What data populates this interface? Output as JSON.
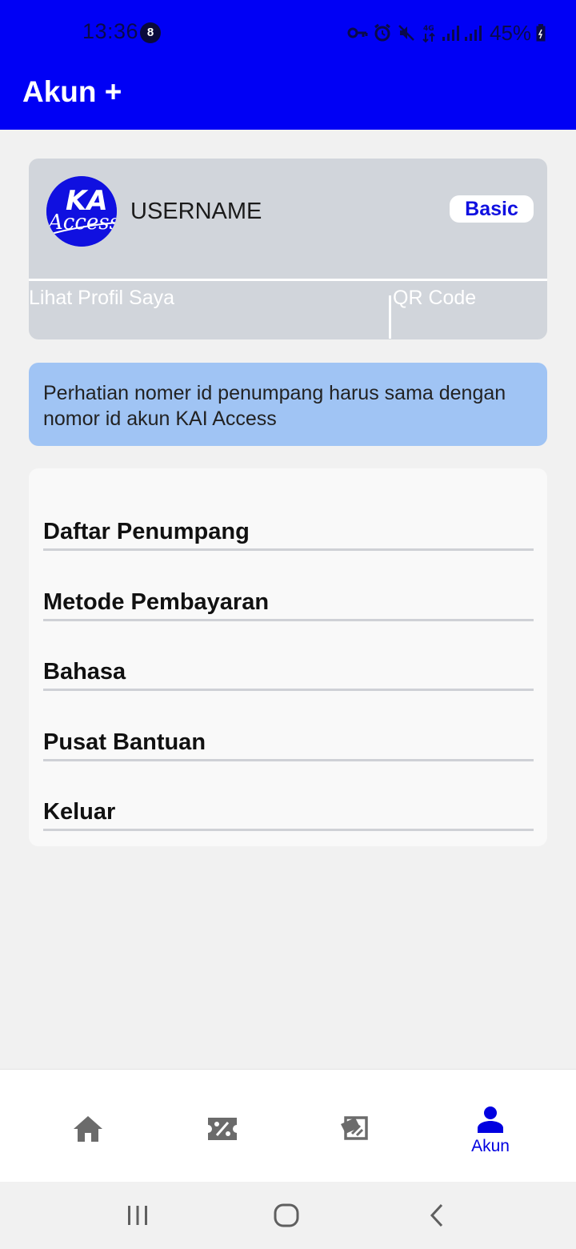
{
  "status_bar": {
    "time": "13:36",
    "notification_count": "8",
    "battery": "45%"
  },
  "app_bar": {
    "title": "Akun +"
  },
  "profile": {
    "username": "USERNAME",
    "tier": "Basic",
    "view_profile_label": "Lihat Profil Saya",
    "qr_label": "QR Code",
    "logo_text": "KAI Access"
  },
  "notice": {
    "text": "Perhatian nomer id penumpang harus sama dengan nomor id akun KAI Access"
  },
  "menu": {
    "items": [
      {
        "label": "Daftar Penumpang"
      },
      {
        "label": "Metode Pembayaran"
      },
      {
        "label": "Bahasa"
      },
      {
        "label": "Pusat Bantuan"
      },
      {
        "label": "Keluar"
      }
    ]
  },
  "bottom_nav": {
    "items": [
      {
        "icon": "home-icon",
        "label": ""
      },
      {
        "icon": "promo-ticket-icon",
        "label": ""
      },
      {
        "icon": "ticket-icon",
        "label": ""
      },
      {
        "icon": "person-icon",
        "label": "Akun",
        "active": true
      }
    ]
  },
  "colors": {
    "primary": "#0000f5",
    "background": "#f1f1f1",
    "card_gray": "#d1d5db",
    "notice_blue": "#a0c4f4",
    "nav_inactive": "#6b6b6b",
    "nav_active": "#0000e0"
  }
}
